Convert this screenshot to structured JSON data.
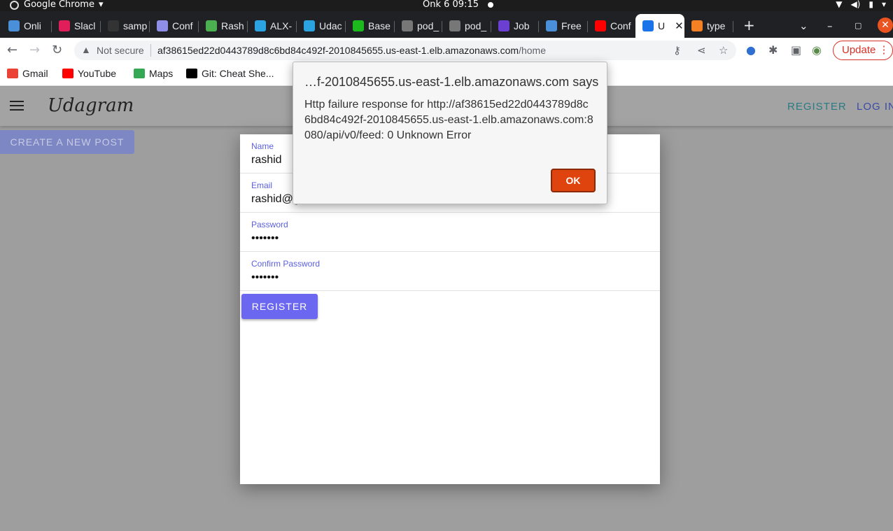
{
  "os": {
    "app_name": "Google Chrome",
    "clock": "Onk 6  09:15"
  },
  "tabs": [
    {
      "label": "Onli",
      "color": "#4a90d9"
    },
    {
      "label": "Slacl",
      "color": "#e01e5a"
    },
    {
      "label": "samp",
      "color": "#333333"
    },
    {
      "label": "Conf",
      "color": "#8e8ee8"
    },
    {
      "label": "Rash",
      "color": "#4caf50"
    },
    {
      "label": "ALX-",
      "color": "#2aa3e0"
    },
    {
      "label": "Udac",
      "color": "#2aa3e0"
    },
    {
      "label": "Base",
      "color": "#1db81d"
    },
    {
      "label": "pod_",
      "color": "#777777"
    },
    {
      "label": "pod_",
      "color": "#777777"
    },
    {
      "label": "Job",
      "color": "#6a3fd1"
    },
    {
      "label": "Free",
      "color": "#4a90d9"
    },
    {
      "label": "Conf",
      "color": "#ff0000"
    },
    {
      "label": "U",
      "color": "#1a73e8"
    },
    {
      "label": "type",
      "color": "#f48024"
    }
  ],
  "toolbar": {
    "security": "Not secure",
    "url_host": "af38615ed22d0443789d8c6bd84c492f-2010845655.us-east-1.elb.amazonaws.com",
    "url_path": "/home",
    "update_label": "Update"
  },
  "bookmarks": [
    {
      "label": "Gmail",
      "color": "#ea4335"
    },
    {
      "label": "YouTube",
      "color": "#ff0000"
    },
    {
      "label": "Maps",
      "color": "#34a853"
    },
    {
      "label": "Git: Cheat She...",
      "color": "#000000"
    }
  ],
  "app": {
    "brand": "Udagram",
    "nav_register": "REGISTER",
    "nav_login": "LOG IN",
    "create_post": "CREATE A NEW POST"
  },
  "form": {
    "fields": [
      {
        "label": "Name",
        "value": "rashid"
      },
      {
        "label": "Email",
        "value": "rashid@g"
      },
      {
        "label": "Password",
        "value": "•••••••"
      },
      {
        "label": "Confirm Password",
        "value": "•••••••"
      }
    ],
    "submit": "REGISTER"
  },
  "alert": {
    "title": "…f-2010845655.us-east-1.elb.amazonaws.com says",
    "message": "Http failure response for http://af38615ed22d0443789d8c6bd84c492f-2010845655.us-east-1.elb.amazonaws.com:8080/api/v0/feed: 0 Unknown Error",
    "ok": "OK"
  }
}
